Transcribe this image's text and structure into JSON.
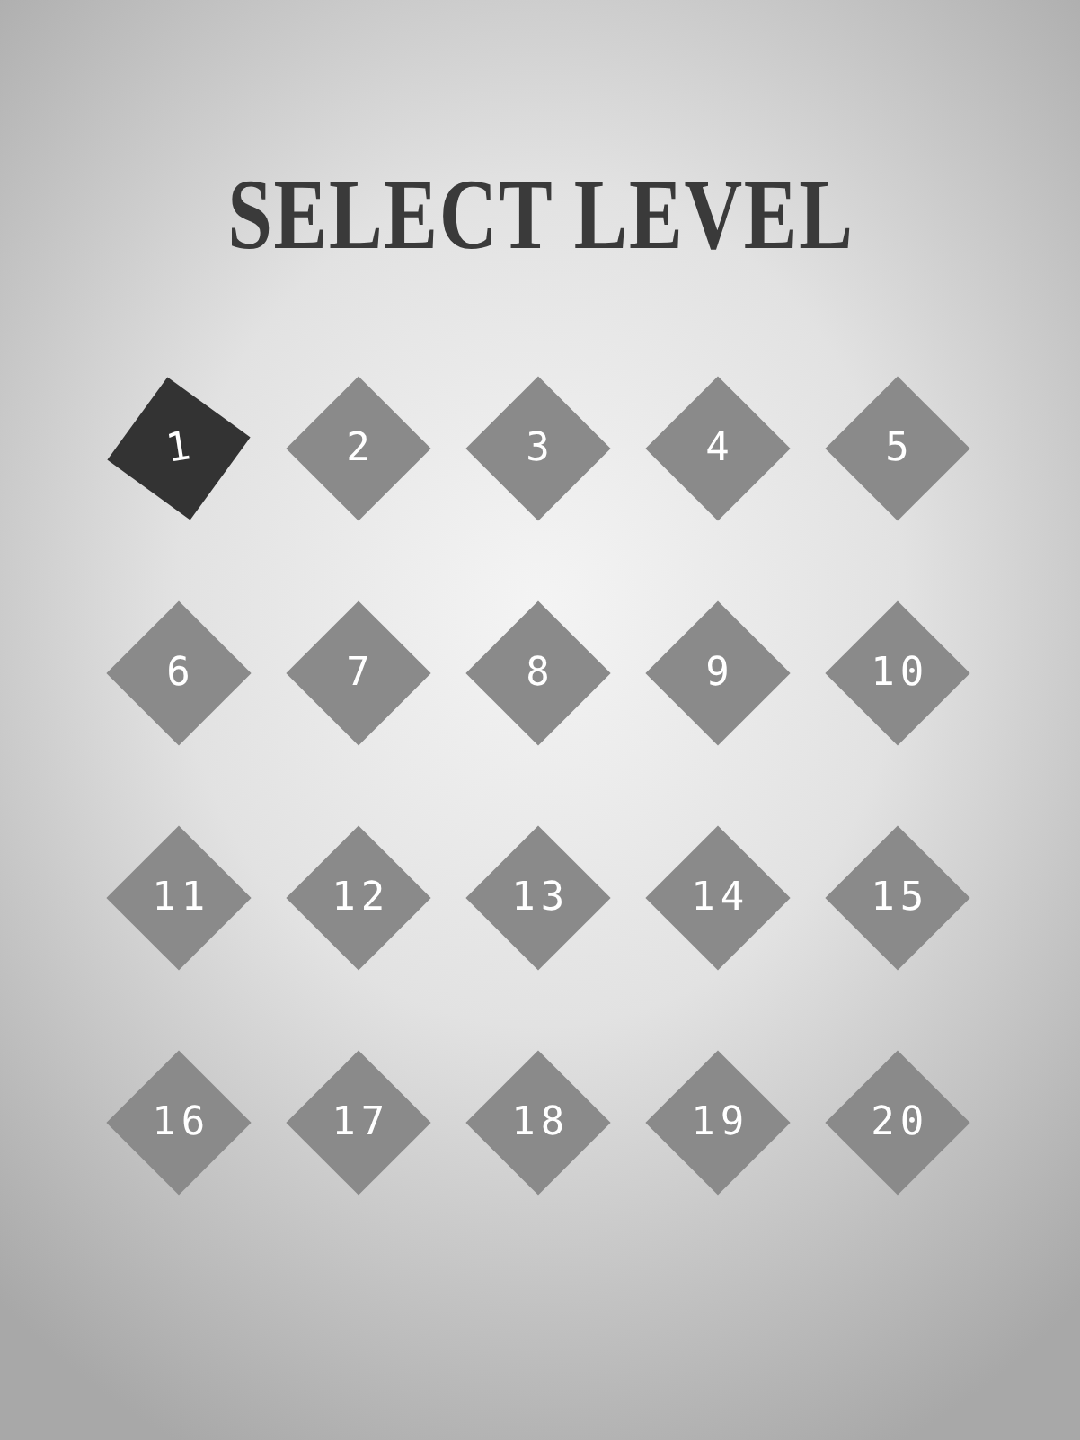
{
  "title": "SELECT LEVEL",
  "levels": [
    {
      "label": "1",
      "selected": true
    },
    {
      "label": "2",
      "selected": false
    },
    {
      "label": "3",
      "selected": false
    },
    {
      "label": "4",
      "selected": false
    },
    {
      "label": "5",
      "selected": false
    },
    {
      "label": "6",
      "selected": false
    },
    {
      "label": "7",
      "selected": false
    },
    {
      "label": "8",
      "selected": false
    },
    {
      "label": "9",
      "selected": false
    },
    {
      "label": "10",
      "selected": false
    },
    {
      "label": "11",
      "selected": false
    },
    {
      "label": "12",
      "selected": false
    },
    {
      "label": "13",
      "selected": false
    },
    {
      "label": "14",
      "selected": false
    },
    {
      "label": "15",
      "selected": false
    },
    {
      "label": "16",
      "selected": false
    },
    {
      "label": "17",
      "selected": false
    },
    {
      "label": "18",
      "selected": false
    },
    {
      "label": "19",
      "selected": false
    },
    {
      "label": "20",
      "selected": false
    }
  ]
}
